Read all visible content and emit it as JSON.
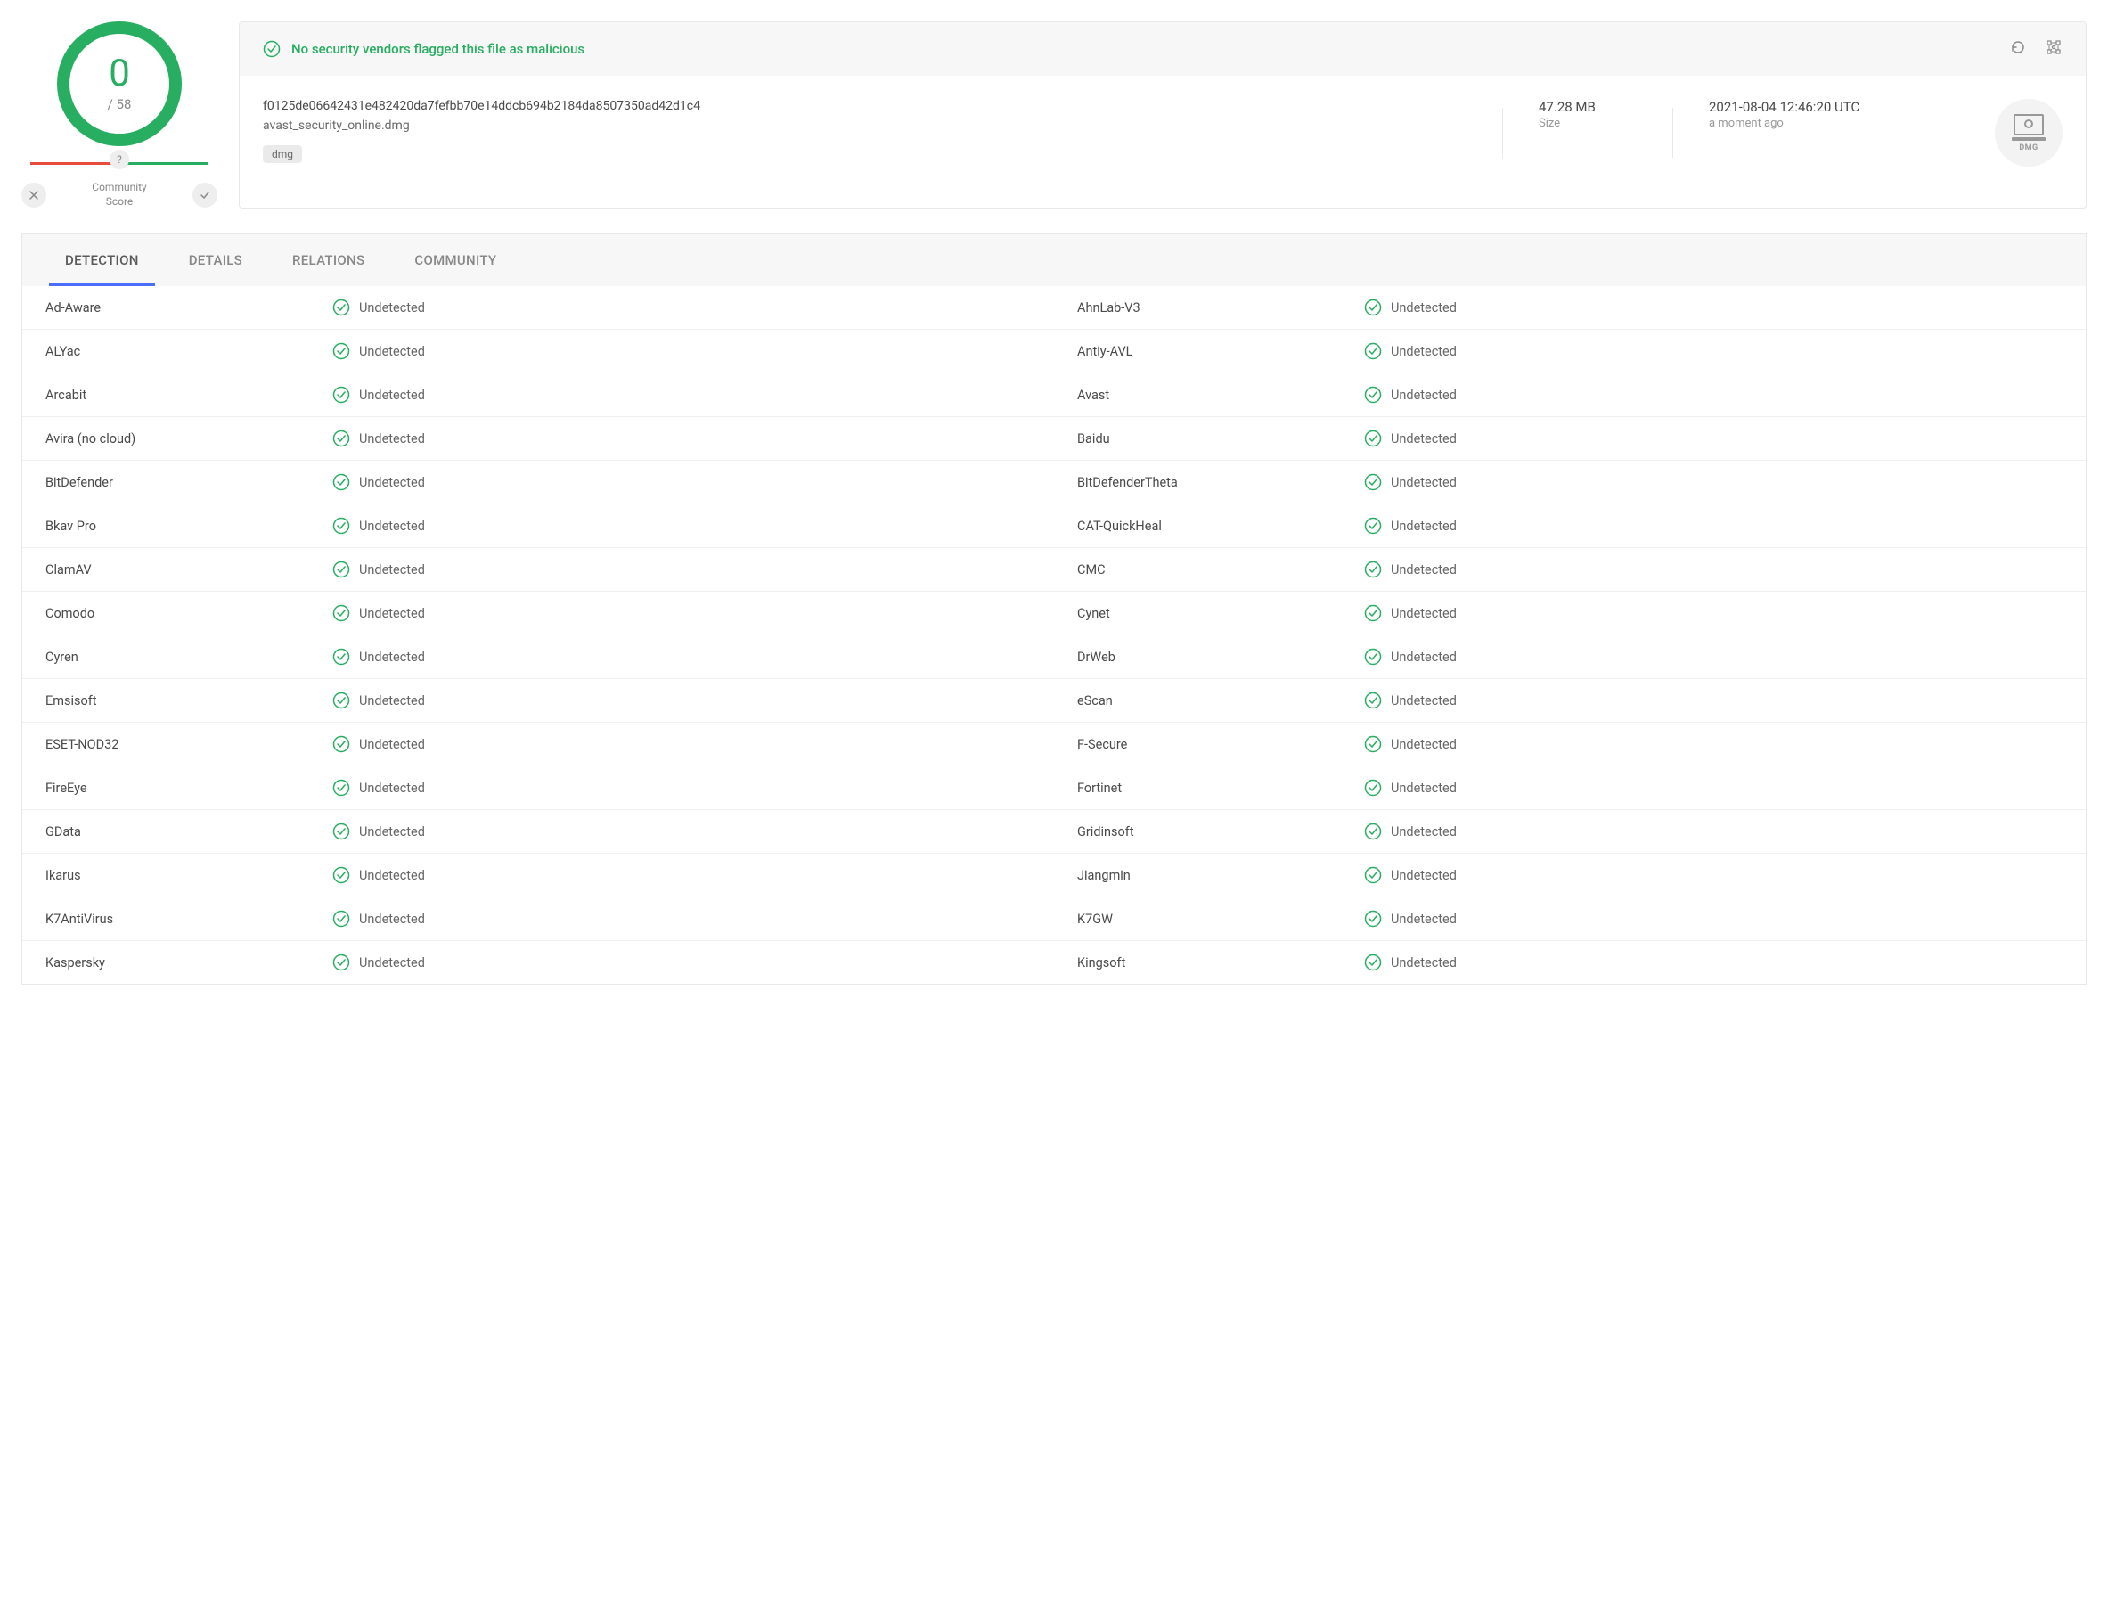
{
  "score": {
    "detections": "0",
    "total": "/ 58"
  },
  "community": {
    "marker": "?",
    "label_line1": "Community",
    "label_line2": "Score"
  },
  "status": {
    "message": "No security vendors flagged this file as malicious"
  },
  "file": {
    "hash": "f0125de06642431e482420da7fefbb70e14ddcb694b2184da8507350ad42d1c4",
    "name": "avast_security_online.dmg",
    "tag": "dmg",
    "size_value": "47.28 MB",
    "size_label": "Size",
    "date_value": "2021-08-04 12:46:20 UTC",
    "date_label": "a moment ago",
    "type_label": "DMG"
  },
  "tabs": {
    "detection": "DETECTION",
    "details": "DETAILS",
    "relations": "RELATIONS",
    "community": "COMMUNITY"
  },
  "undetected_label": "Undetected",
  "vendors": [
    [
      "Ad-Aware",
      "AhnLab-V3"
    ],
    [
      "ALYac",
      "Antiy-AVL"
    ],
    [
      "Arcabit",
      "Avast"
    ],
    [
      "Avira (no cloud)",
      "Baidu"
    ],
    [
      "BitDefender",
      "BitDefenderTheta"
    ],
    [
      "Bkav Pro",
      "CAT-QuickHeal"
    ],
    [
      "ClamAV",
      "CMC"
    ],
    [
      "Comodo",
      "Cynet"
    ],
    [
      "Cyren",
      "DrWeb"
    ],
    [
      "Emsisoft",
      "eScan"
    ],
    [
      "ESET-NOD32",
      "F-Secure"
    ],
    [
      "FireEye",
      "Fortinet"
    ],
    [
      "GData",
      "Gridinsoft"
    ],
    [
      "Ikarus",
      "Jiangmin"
    ],
    [
      "K7AntiVirus",
      "K7GW"
    ],
    [
      "Kaspersky",
      "Kingsoft"
    ]
  ]
}
